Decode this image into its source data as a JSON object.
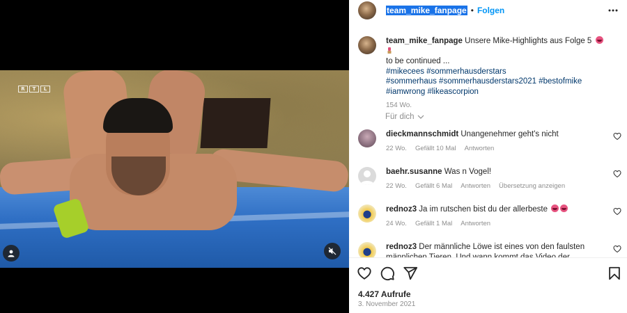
{
  "post": {
    "username": "team_mike_fanpage",
    "follow_label": "Folgen",
    "separator": "•"
  },
  "caption": {
    "username": "team_mike_fanpage",
    "text": "Unsere Mike-Highlights aus Folge 5",
    "text2": "to be continued ...",
    "hashtags_line1": "#mikecees #sommerhausderstars",
    "hashtags_line2": "#sommerhaus #sommerhausderstars2021 #bestofmike",
    "hashtags_line3": "#iamwrong #likeascorpion",
    "age": "154 Wo."
  },
  "sort": {
    "label": "Für dich"
  },
  "video": {
    "channel_logo": [
      "R",
      "T",
      "L"
    ]
  },
  "comments": [
    {
      "username": "dieckmannschmidt",
      "text": "Unangenehmer geht's nicht",
      "age": "22 Wo.",
      "likes": "Gefällt 10 Mal",
      "reply": "Antworten",
      "avatar_color": "#8a6f7e"
    },
    {
      "username": "baehr.susanne",
      "text": "Was n Vogel!",
      "age": "22 Wo.",
      "likes": "Gefällt 6 Mal",
      "reply": "Antworten",
      "translate": "Übersetzung anzeigen",
      "avatar_color": "#dbdbdb"
    },
    {
      "username": "rednoz3",
      "text": "Ja im rutschen bist du der allerbeste",
      "age": "24 Wo.",
      "likes": "Gefällt 1 Mal",
      "reply": "Antworten",
      "avatar_color": "#f2e6b5"
    },
    {
      "username": "rednoz3",
      "text": "Der männliche Löwe ist eines von den faulsten männlichen Tieren. Und wann kommt das Video der",
      "avatar_color": "#f2e6b5"
    }
  ],
  "footer": {
    "views": "4.427 Aufrufe",
    "date": "3. November 2021"
  },
  "icons": {
    "more": "more-horizontal-icon",
    "like": "heart-icon",
    "comment": "comment-icon",
    "share": "paper-plane-icon",
    "save": "bookmark-icon",
    "user_tag": "user-icon",
    "mute": "speaker-muted-icon"
  },
  "colors": {
    "accent": "#0095f6",
    "hashtag": "#00376b",
    "muted_text": "#8e8e8e",
    "selection": "#1a73e8"
  }
}
